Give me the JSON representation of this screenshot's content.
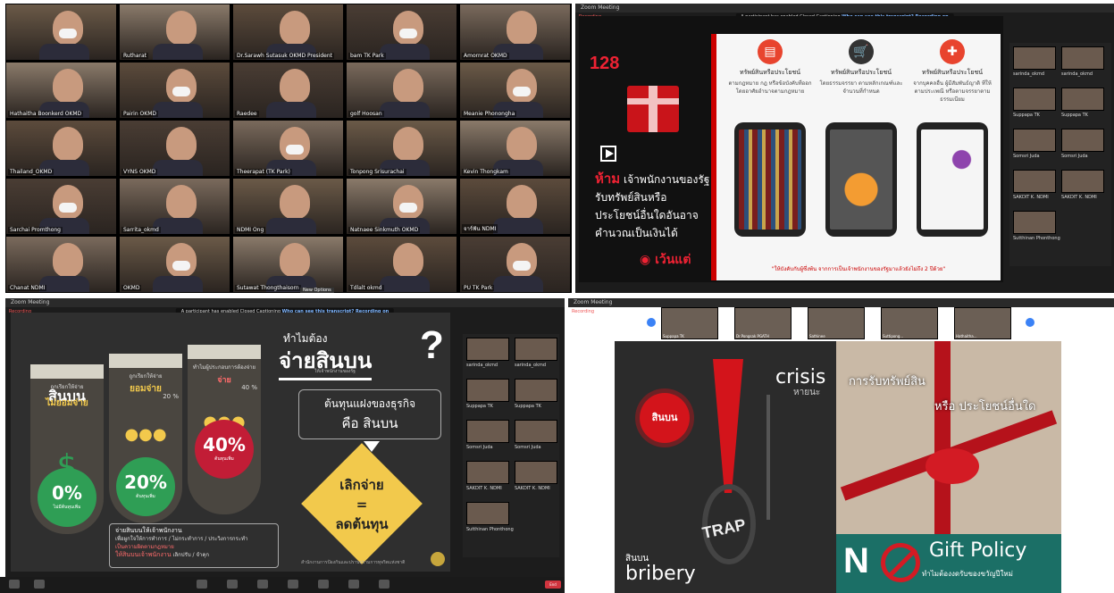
{
  "gallery": {
    "participants": [
      "",
      "Rutharat",
      "Dr.Sarawh Sutasuk OKMD President",
      "bam TK Park",
      "Amornrat OKMD",
      "Hathaitha Boonkerd OKMD",
      "Pairin OKMD",
      "Raedee",
      "golf Hoosan",
      "Meanie Phonongha",
      "Thailand_OKMD",
      "VYNS OKMD",
      "Theerapat (TK Park)",
      "Tonpong Srisurachai",
      "Kevin Thongkam",
      "Sarchai Promthong",
      "Sarrita_okmd",
      "NDMI Ong",
      "Natnaee Sinkmuth OKMD",
      "จาร์ฟัน NDMI",
      "Chanat NDMI",
      "OKMD",
      "Sutawat Thongthaisorn",
      "Tdlalt okmd",
      "PU TK Park"
    ],
    "extra_chip": "New Options"
  },
  "zoom": {
    "title": "Zoom Meeting",
    "recording": "Recording",
    "banner_prefix": "A participant has enabled Closed Captioning",
    "banner_link": "Who can see this transcript? Recording on"
  },
  "slide1": {
    "number": "128",
    "ban_word": "ห้าม",
    "ban_text": "เจ้าพนักงานของรัฐรับทรัพย์สินหรือประโยชน์อื่นใดอันอาจคำนวณเป็นเงินได้",
    "except": "เว้นแต่",
    "columns": [
      {
        "title": "ทรัพย์สินหรือประโยชน์",
        "desc": "ตามกฎหมาย กฎ หรือข้อบังคับที่ออกโดยอาศัยอำนาจตามกฎหมาย"
      },
      {
        "title": "ทรัพย์สินหรือประโยชน์",
        "desc": "โดยธรรมจรรยา ตามหลักเกณฑ์และจำนวนที่กำหนด"
      },
      {
        "title": "ทรัพย์สินหรือประโยชน์",
        "desc": "จากบุคคลอื่น ผู้มีสัมพันธ์ญาติ ที่ให้ตามประเพณี หรือตามจรรยาตามธรรมเนียม"
      }
    ],
    "footer": "\"ให้บังคับกับผู้ซึ่งพ้น จากการเป็นเจ้าพนักงานของรัฐมาแล้วยังไม่ถึง 2 ปีด้วย\""
  },
  "side1": {
    "names": [
      "sarinda_okmd",
      "sarinda_okmd",
      "Suppapa TK",
      "Suppapa TK",
      "Somsri Juda",
      "Somsri Juda",
      "SAKDIT K. NDMI",
      "SAKDIT K. NDMI",
      "Sutthinan Phonthong"
    ]
  },
  "slide2": {
    "pillars": [
      {
        "head": "ถูกเรียกให้จ่าย",
        "big": "สินบน",
        "word": "ไม่ยอมจ่าย",
        "pct": "0%",
        "sub": "ไม่มีต้นทุนเพิ่ม",
        "color": "#2f9e55"
      },
      {
        "head": "ถูกเรียกให้จ่าย",
        "big": "",
        "word": "ยอมจ่าย",
        "pct": "20%",
        "sub": "ต้นทุนเพิ่ม",
        "mini": "20 %",
        "color": "#2f9e55"
      },
      {
        "head": "ทำไมผู้ประกอบการต้องจ่าย",
        "big": "",
        "word": "จ่าย",
        "pct": "40%",
        "sub": "ต้นทุนเพิ่ม",
        "mini": "40 %",
        "color": "#c21d36"
      }
    ],
    "question": "ทำไมต้อง",
    "headline": "จ่ายสินบน",
    "small": "ให้เจ้าพนักงานของรัฐ",
    "cost_line1": "ต้นทุนแฝงของธุรกิจ",
    "cost_line2": "คือ สินบน",
    "stop_line1": "เลิกจ่าย",
    "stop_eq": "=",
    "stop_line2": "ลดต้นทุน",
    "box_title": "จ่ายสินบนให้เจ้าพนักงาน",
    "box_l1": "เพื่อผูกใจให้การทำการ / ไม่กระทำการ / ประวิงการกระทำ",
    "box_l2": "เป็นความผิดตามกฎหมาย",
    "box_l3": "ให้สินบนเจ้าพนักงาน",
    "box_l4": "เลิกปรับ / จำคุก",
    "footer": "สำนักงานการป้องกันและปราบปรามการทุจริตแห่งชาติ"
  },
  "controls": [
    "Unmute",
    "Start Video",
    "Participants",
    "Chat",
    "Share Screen",
    "Record",
    "Reactions",
    "Apps",
    "Whiteboards",
    "End"
  ],
  "slide3": {
    "bribe_th": "สินบน",
    "crisis": "crisis",
    "crisis_th": "หายนะ",
    "trap": "TRAP",
    "bribery_th": "สินบน",
    "bribery": "bribery",
    "accept": "การรับทรัพย์สิน",
    "accept2": "หรือ ประโยชน์อื่นใด",
    "n": "N",
    "gift_policy": "Gift Policy",
    "gift_sub": "ทำไมต้องงดรับของขวัญปีใหม่"
  },
  "top3": {
    "names": [
      "Suppapa TK",
      "Dr.Pongsak PGATH",
      "Sathinee",
      "Suttipong...",
      "Hathaitha..."
    ]
  }
}
